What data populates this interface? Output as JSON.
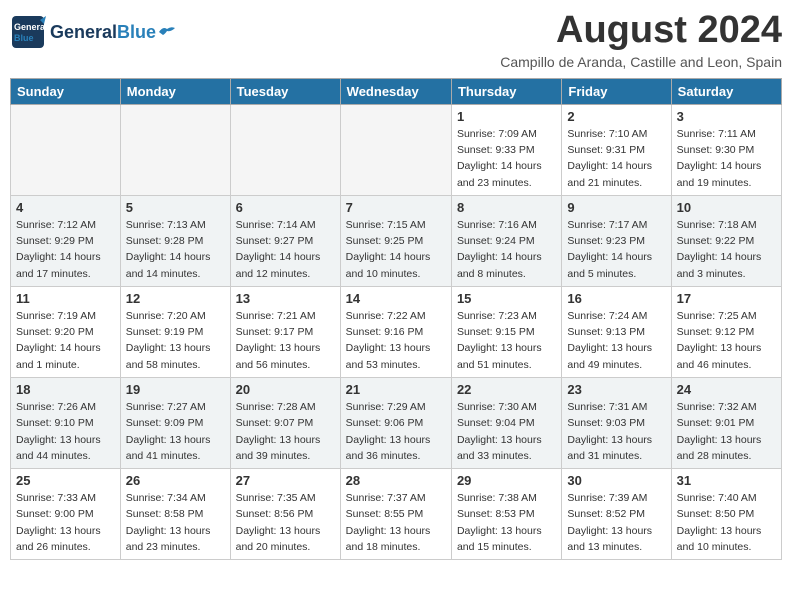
{
  "header": {
    "logo_general": "General",
    "logo_blue": "Blue",
    "month_year": "August 2024",
    "location": "Campillo de Aranda, Castille and Leon, Spain"
  },
  "days_of_week": [
    "Sunday",
    "Monday",
    "Tuesday",
    "Wednesday",
    "Thursday",
    "Friday",
    "Saturday"
  ],
  "weeks": [
    [
      {
        "num": "",
        "empty": true
      },
      {
        "num": "",
        "empty": true
      },
      {
        "num": "",
        "empty": true
      },
      {
        "num": "",
        "empty": true
      },
      {
        "num": "1",
        "sunrise": "7:09 AM",
        "sunset": "9:33 PM",
        "daylight": "14 hours and 23 minutes."
      },
      {
        "num": "2",
        "sunrise": "7:10 AM",
        "sunset": "9:31 PM",
        "daylight": "14 hours and 21 minutes."
      },
      {
        "num": "3",
        "sunrise": "7:11 AM",
        "sunset": "9:30 PM",
        "daylight": "14 hours and 19 minutes."
      }
    ],
    [
      {
        "num": "4",
        "sunrise": "7:12 AM",
        "sunset": "9:29 PM",
        "daylight": "14 hours and 17 minutes."
      },
      {
        "num": "5",
        "sunrise": "7:13 AM",
        "sunset": "9:28 PM",
        "daylight": "14 hours and 14 minutes."
      },
      {
        "num": "6",
        "sunrise": "7:14 AM",
        "sunset": "9:27 PM",
        "daylight": "14 hours and 12 minutes."
      },
      {
        "num": "7",
        "sunrise": "7:15 AM",
        "sunset": "9:25 PM",
        "daylight": "14 hours and 10 minutes."
      },
      {
        "num": "8",
        "sunrise": "7:16 AM",
        "sunset": "9:24 PM",
        "daylight": "14 hours and 8 minutes."
      },
      {
        "num": "9",
        "sunrise": "7:17 AM",
        "sunset": "9:23 PM",
        "daylight": "14 hours and 5 minutes."
      },
      {
        "num": "10",
        "sunrise": "7:18 AM",
        "sunset": "9:22 PM",
        "daylight": "14 hours and 3 minutes."
      }
    ],
    [
      {
        "num": "11",
        "sunrise": "7:19 AM",
        "sunset": "9:20 PM",
        "daylight": "14 hours and 1 minute."
      },
      {
        "num": "12",
        "sunrise": "7:20 AM",
        "sunset": "9:19 PM",
        "daylight": "13 hours and 58 minutes."
      },
      {
        "num": "13",
        "sunrise": "7:21 AM",
        "sunset": "9:17 PM",
        "daylight": "13 hours and 56 minutes."
      },
      {
        "num": "14",
        "sunrise": "7:22 AM",
        "sunset": "9:16 PM",
        "daylight": "13 hours and 53 minutes."
      },
      {
        "num": "15",
        "sunrise": "7:23 AM",
        "sunset": "9:15 PM",
        "daylight": "13 hours and 51 minutes."
      },
      {
        "num": "16",
        "sunrise": "7:24 AM",
        "sunset": "9:13 PM",
        "daylight": "13 hours and 49 minutes."
      },
      {
        "num": "17",
        "sunrise": "7:25 AM",
        "sunset": "9:12 PM",
        "daylight": "13 hours and 46 minutes."
      }
    ],
    [
      {
        "num": "18",
        "sunrise": "7:26 AM",
        "sunset": "9:10 PM",
        "daylight": "13 hours and 44 minutes."
      },
      {
        "num": "19",
        "sunrise": "7:27 AM",
        "sunset": "9:09 PM",
        "daylight": "13 hours and 41 minutes."
      },
      {
        "num": "20",
        "sunrise": "7:28 AM",
        "sunset": "9:07 PM",
        "daylight": "13 hours and 39 minutes."
      },
      {
        "num": "21",
        "sunrise": "7:29 AM",
        "sunset": "9:06 PM",
        "daylight": "13 hours and 36 minutes."
      },
      {
        "num": "22",
        "sunrise": "7:30 AM",
        "sunset": "9:04 PM",
        "daylight": "13 hours and 33 minutes."
      },
      {
        "num": "23",
        "sunrise": "7:31 AM",
        "sunset": "9:03 PM",
        "daylight": "13 hours and 31 minutes."
      },
      {
        "num": "24",
        "sunrise": "7:32 AM",
        "sunset": "9:01 PM",
        "daylight": "13 hours and 28 minutes."
      }
    ],
    [
      {
        "num": "25",
        "sunrise": "7:33 AM",
        "sunset": "9:00 PM",
        "daylight": "13 hours and 26 minutes."
      },
      {
        "num": "26",
        "sunrise": "7:34 AM",
        "sunset": "8:58 PM",
        "daylight": "13 hours and 23 minutes."
      },
      {
        "num": "27",
        "sunrise": "7:35 AM",
        "sunset": "8:56 PM",
        "daylight": "13 hours and 20 minutes."
      },
      {
        "num": "28",
        "sunrise": "7:37 AM",
        "sunset": "8:55 PM",
        "daylight": "13 hours and 18 minutes."
      },
      {
        "num": "29",
        "sunrise": "7:38 AM",
        "sunset": "8:53 PM",
        "daylight": "13 hours and 15 minutes."
      },
      {
        "num": "30",
        "sunrise": "7:39 AM",
        "sunset": "8:52 PM",
        "daylight": "13 hours and 13 minutes."
      },
      {
        "num": "31",
        "sunrise": "7:40 AM",
        "sunset": "8:50 PM",
        "daylight": "13 hours and 10 minutes."
      }
    ]
  ],
  "labels": {
    "sunrise": "Sunrise:",
    "sunset": "Sunset:",
    "daylight": "Daylight:"
  },
  "colors": {
    "header_bg": "#2471a3",
    "accent": "#2980b9"
  }
}
